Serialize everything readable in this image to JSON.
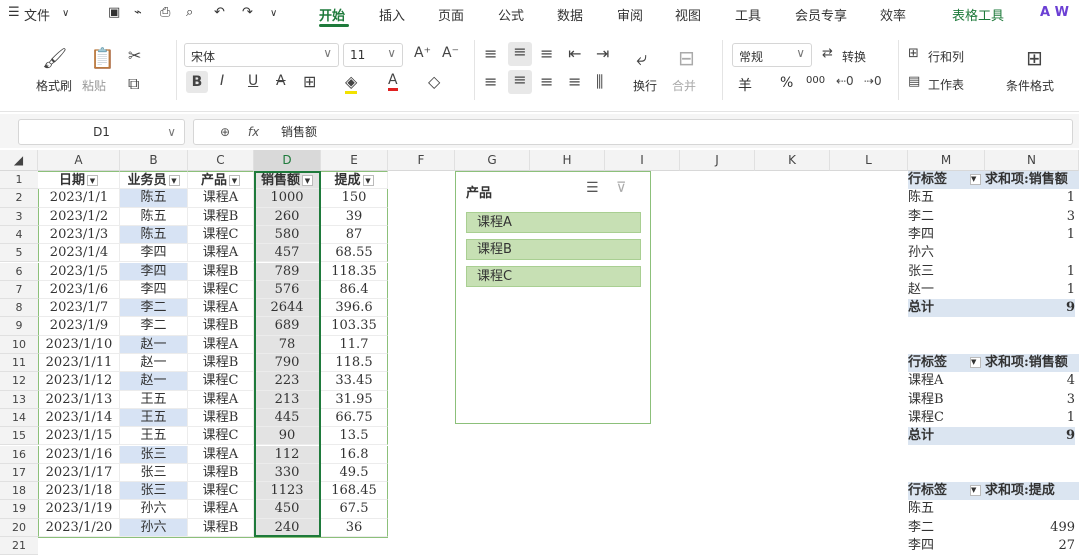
{
  "menu": {
    "file": "文件",
    "tabs": [
      "开始",
      "插入",
      "页面",
      "公式",
      "数据",
      "审阅",
      "视图",
      "工具",
      "会员专享",
      "效率",
      "表格工具"
    ],
    "active": "开始"
  },
  "ribbon": {
    "format_painter": "格式刷",
    "paste": "粘贴",
    "font_name": "宋体",
    "font_size": "11",
    "bold": "B",
    "italic": "I",
    "underline": "U",
    "strike": "A",
    "wrap": "换行",
    "merge": "合并",
    "number_format": "常规",
    "convert": "转换",
    "row_col": "行和列",
    "worksheet": "工作表",
    "cond_format": "条件格式",
    "currency": "羊",
    "percent": "%",
    "thousands": "000"
  },
  "formula_bar": {
    "name_box": "D1",
    "fx": "fx",
    "content": "销售额"
  },
  "columns": [
    "A",
    "B",
    "C",
    "D",
    "E",
    "F",
    "G",
    "H",
    "I",
    "J",
    "K",
    "L",
    "M",
    "N"
  ],
  "row_numbers": [
    "1",
    "2",
    "3",
    "4",
    "5",
    "6",
    "7",
    "8",
    "9",
    "10",
    "11",
    "12",
    "13",
    "14",
    "15",
    "16",
    "17",
    "18",
    "19",
    "20",
    "21"
  ],
  "table_headers": [
    "日期",
    "业务员",
    "产品",
    "销售额",
    "提成"
  ],
  "rows": [
    [
      "2023/1/1",
      "陈五",
      "课程A",
      "1000",
      "150"
    ],
    [
      "2023/1/2",
      "陈五",
      "课程B",
      "260",
      "39"
    ],
    [
      "2023/1/3",
      "陈五",
      "课程C",
      "580",
      "87"
    ],
    [
      "2023/1/4",
      "李四",
      "课程A",
      "457",
      "68.55"
    ],
    [
      "2023/1/5",
      "李四",
      "课程B",
      "789",
      "118.35"
    ],
    [
      "2023/1/6",
      "李四",
      "课程C",
      "576",
      "86.4"
    ],
    [
      "2023/1/7",
      "李二",
      "课程A",
      "2644",
      "396.6"
    ],
    [
      "2023/1/9",
      "李二",
      "课程B",
      "689",
      "103.35"
    ],
    [
      "2023/1/10",
      "赵一",
      "课程A",
      "78",
      "11.7"
    ],
    [
      "2023/1/11",
      "赵一",
      "课程B",
      "790",
      "118.5"
    ],
    [
      "2023/1/12",
      "赵一",
      "课程C",
      "223",
      "33.45"
    ],
    [
      "2023/1/13",
      "王五",
      "课程A",
      "213",
      "31.95"
    ],
    [
      "2023/1/14",
      "王五",
      "课程B",
      "445",
      "66.75"
    ],
    [
      "2023/1/15",
      "王五",
      "课程C",
      "90",
      "13.5"
    ],
    [
      "2023/1/16",
      "张三",
      "课程A",
      "112",
      "16.8"
    ],
    [
      "2023/1/17",
      "张三",
      "课程B",
      "330",
      "49.5"
    ],
    [
      "2023/1/18",
      "张三",
      "课程C",
      "1123",
      "168.45"
    ],
    [
      "2023/1/19",
      "孙六",
      "课程A",
      "450",
      "67.5"
    ],
    [
      "2023/1/20",
      "孙六",
      "课程B",
      "240",
      "36"
    ]
  ],
  "slicer": {
    "title": "产品",
    "items": [
      "课程A",
      "课程B",
      "课程C"
    ]
  },
  "pivot1": {
    "header_label": "行标签",
    "header_value": "求和项:销售额",
    "rows": [
      [
        "陈五",
        "1"
      ],
      [
        "李二",
        "3"
      ],
      [
        "李四",
        "1"
      ],
      [
        "孙六",
        ""
      ],
      [
        "张三",
        "1"
      ],
      [
        "赵一",
        "1"
      ]
    ],
    "total_label": "总计",
    "total_value": "9"
  },
  "pivot2": {
    "header_label": "行标签",
    "header_value": "求和项:销售额",
    "rows": [
      [
        "课程A",
        "4"
      ],
      [
        "课程B",
        "3"
      ],
      [
        "课程C",
        "1"
      ]
    ],
    "total_label": "总计",
    "total_value": "9"
  },
  "pivot3": {
    "header_label": "行标签",
    "header_value": "求和项:提成",
    "rows": [
      [
        "陈五",
        ""
      ],
      [
        "李二",
        "499"
      ],
      [
        "李四",
        "27"
      ]
    ]
  }
}
